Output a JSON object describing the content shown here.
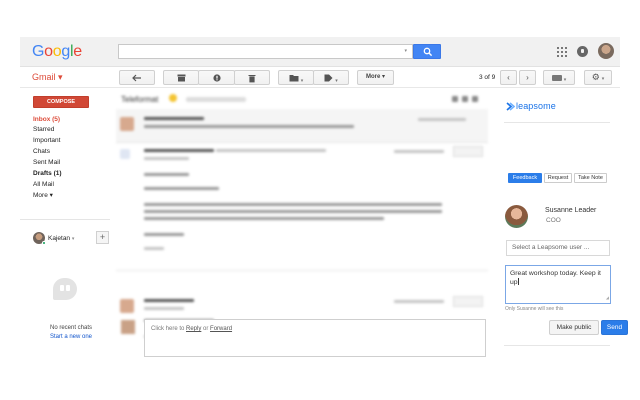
{
  "header": {
    "logo_letters": [
      {
        "ch": "G",
        "color": "#4285f4"
      },
      {
        "ch": "o",
        "color": "#ea4335"
      },
      {
        "ch": "o",
        "color": "#fbbc05"
      },
      {
        "ch": "g",
        "color": "#4285f4"
      },
      {
        "ch": "l",
        "color": "#34a853"
      },
      {
        "ch": "e",
        "color": "#ea4335"
      }
    ],
    "search_icon": "search-icon",
    "apps_icon": "apps-grid-icon",
    "notifications_icon": "notifications-icon"
  },
  "toolbar": {
    "gmail_label": "Gmail ▾",
    "back_icon": "arrow-left-icon",
    "archive_icon": "archive-icon",
    "spam_icon": "report-spam-icon",
    "delete_icon": "trash-icon",
    "move_icon": "folder-icon",
    "labels_icon": "label-icon",
    "more_label": "More ▾",
    "page_count": "3 of 9",
    "settings_icon": "gear-icon"
  },
  "nav": {
    "compose_label": "COMPOSE",
    "items": [
      {
        "label": "Inbox (5)",
        "style": "active"
      },
      {
        "label": "Starred",
        "style": ""
      },
      {
        "label": "Important",
        "style": ""
      },
      {
        "label": "Chats",
        "style": ""
      },
      {
        "label": "Sent Mail",
        "style": ""
      },
      {
        "label": "Drafts (1)",
        "style": "bold"
      },
      {
        "label": "All Mail",
        "style": ""
      },
      {
        "label": "More ▾",
        "style": ""
      }
    ],
    "me_name": "Kajetan",
    "add_label": "+",
    "no_chats": "No recent chats",
    "start_new": "Start a new one"
  },
  "thread": {
    "subject": "Teleformat",
    "composer_prefix": "Click here to ",
    "composer_reply": "Reply",
    "composer_or": " or ",
    "composer_forward": "Forward"
  },
  "leapsome": {
    "brand": "leapsome",
    "brand_color": "#1a73e8",
    "tabs": [
      "Feedback",
      "Request",
      "Take Note"
    ],
    "active_tab": "Feedback",
    "person_name": "Susanne Leader",
    "person_role": "COO",
    "user_placeholder": "Select a Leapsome user ...",
    "feedback_text": "Great workshop today. Keep it up",
    "visibility_note": "Only Susanne will see this",
    "make_public_label": "Make public",
    "send_label": "Send"
  }
}
